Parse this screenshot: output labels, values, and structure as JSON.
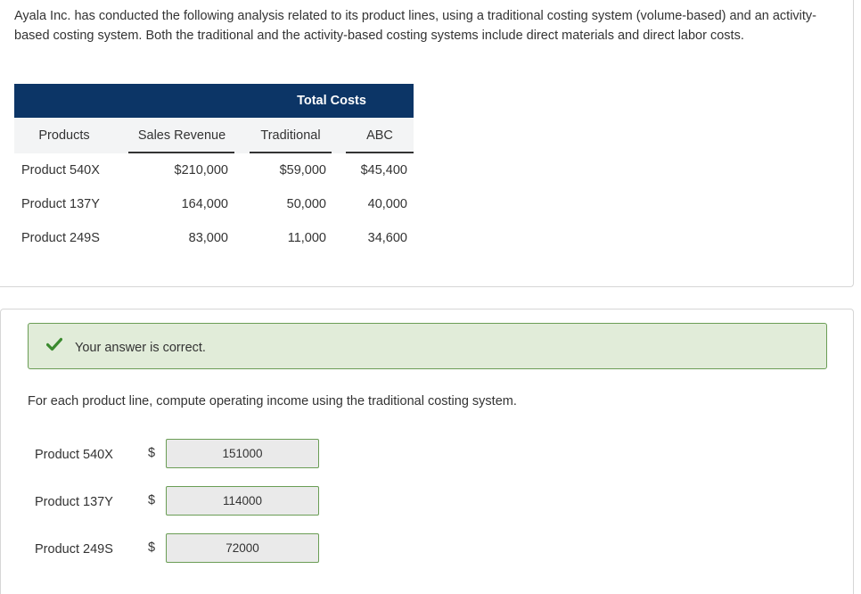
{
  "problem": {
    "intro": "Ayala Inc. has conducted the following analysis related to its product lines, using a traditional costing system (volume-based) and an activity-based costing system. Both the traditional and the activity-based costing systems include direct materials and direct labor costs."
  },
  "table": {
    "group_header": "Total Costs",
    "columns": [
      "Products",
      "Sales Revenue",
      "Traditional",
      "ABC"
    ],
    "rows": [
      [
        "Product 540X",
        "$210,000",
        "$59,000",
        "$45,400"
      ],
      [
        "Product 137Y",
        "164,000",
        "50,000",
        "40,000"
      ],
      [
        "Product 249S",
        "83,000",
        "11,000",
        "34,600"
      ]
    ],
    "header_color": "#0c3566"
  },
  "feedback": {
    "message": "Your answer is correct.",
    "status_color": "#3a8a2e"
  },
  "question": {
    "instruction": "For each product line, compute operating income using the traditional costing system.",
    "currency": "$",
    "answers": [
      {
        "label": "Product 540X",
        "value": "151000"
      },
      {
        "label": "Product 137Y",
        "value": "114000"
      },
      {
        "label": "Product 249S",
        "value": "72000"
      }
    ]
  }
}
